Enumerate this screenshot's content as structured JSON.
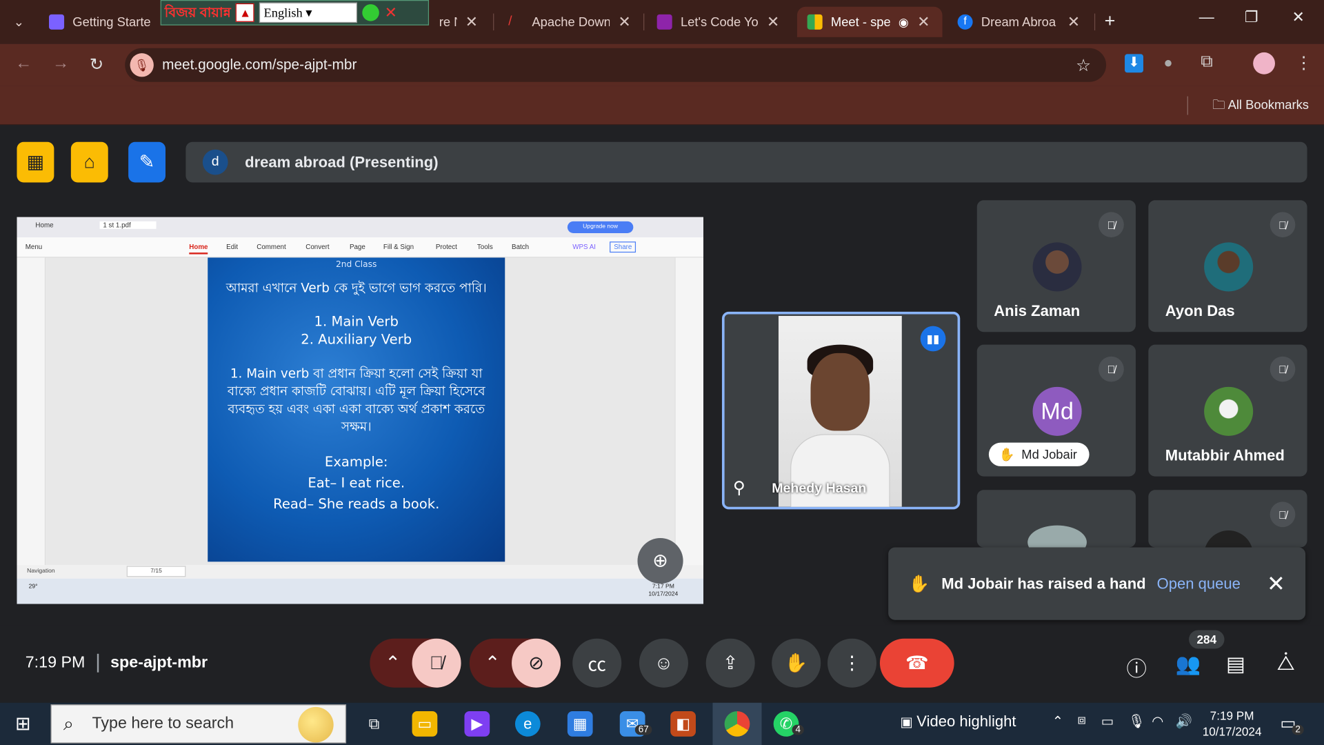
{
  "browser": {
    "tabs": [
      {
        "label": "Getting Starte",
        "color": "#7b61ff"
      },
      {
        "label": "re Ne",
        "color": "#333"
      },
      {
        "label": "Apache Down",
        "color": "#c2185b"
      },
      {
        "label": "Let's Code You",
        "color": "#8e24aa"
      },
      {
        "label": "Meet - spe",
        "color": "#34a853"
      },
      {
        "label": "Dream Abroa",
        "color": "#1877f2"
      }
    ],
    "url": "meet.google.com/spe-ajpt-mbr",
    "bookmarks_label": "All Bookmarks",
    "lang_overlay": {
      "bangla": "বিজয় বায়ান্ন",
      "select_value": "English"
    }
  },
  "meet": {
    "presenting_avatar": "d",
    "presenting_label": "dream abroad (Presenting)",
    "shared_screen": {
      "pdf_tabs": {
        "home": "Home",
        "file": "1 st 1.pdf",
        "upgrade": "Upgrade now"
      },
      "menu": [
        "Menu",
        "Home",
        "Edit",
        "Comment",
        "Convert",
        "Page",
        "Fill & Sign",
        "Protect",
        "Tools",
        "Batch",
        "WPS AI",
        "Share"
      ],
      "slide": {
        "header": "2nd Class",
        "line1": "আমরা এখানে Verb কে দুই ভাগে ভাগ করতে পারি।",
        "line2": "1. Main Verb",
        "line3": "2. Auxiliary Verb",
        "line4": "1. Main verb বা প্রধান ক্রিয়া হলো সেই ক্রিয়া যা",
        "line5": "বাক্যে প্রধান কাজটি বোঝায়। এটি মূল ক্রিয়া হিসেবে",
        "line6": "ব্যবহৃত হয় এবং একা একা বাক্যে অর্থ প্রকাশ করতে",
        "line7": "সক্ষম।",
        "line8": "Example:",
        "line9": "Eat– I eat rice.",
        "line10": "Read– She reads a book."
      },
      "status": {
        "nav": "Navigation",
        "page": "7/15"
      },
      "inner_clock": {
        "time": "7:17 PM",
        "date": "10/17/2024"
      },
      "weather": "29°"
    },
    "self_name": "Mehedy Hasan",
    "participants": [
      {
        "name": "Anis Zaman"
      },
      {
        "name": "Ayon Das"
      },
      {
        "name": "Md Jobair",
        "initials": "Md"
      },
      {
        "name": "Mutabbir Ahmed"
      }
    ],
    "notification": {
      "message": "Md Jobair has raised a hand",
      "action": "Open queue"
    },
    "bottom": {
      "time": "7:19 PM",
      "code": "spe-ajpt-mbr",
      "participant_count": "284"
    }
  },
  "taskbar": {
    "search_placeholder": "Type here to search",
    "mail_badge": "67",
    "whatsapp_badge": "4",
    "video_highlight": "Video highlight",
    "time": "7:19 PM",
    "date": "10/17/2024",
    "notif_count": "2"
  }
}
